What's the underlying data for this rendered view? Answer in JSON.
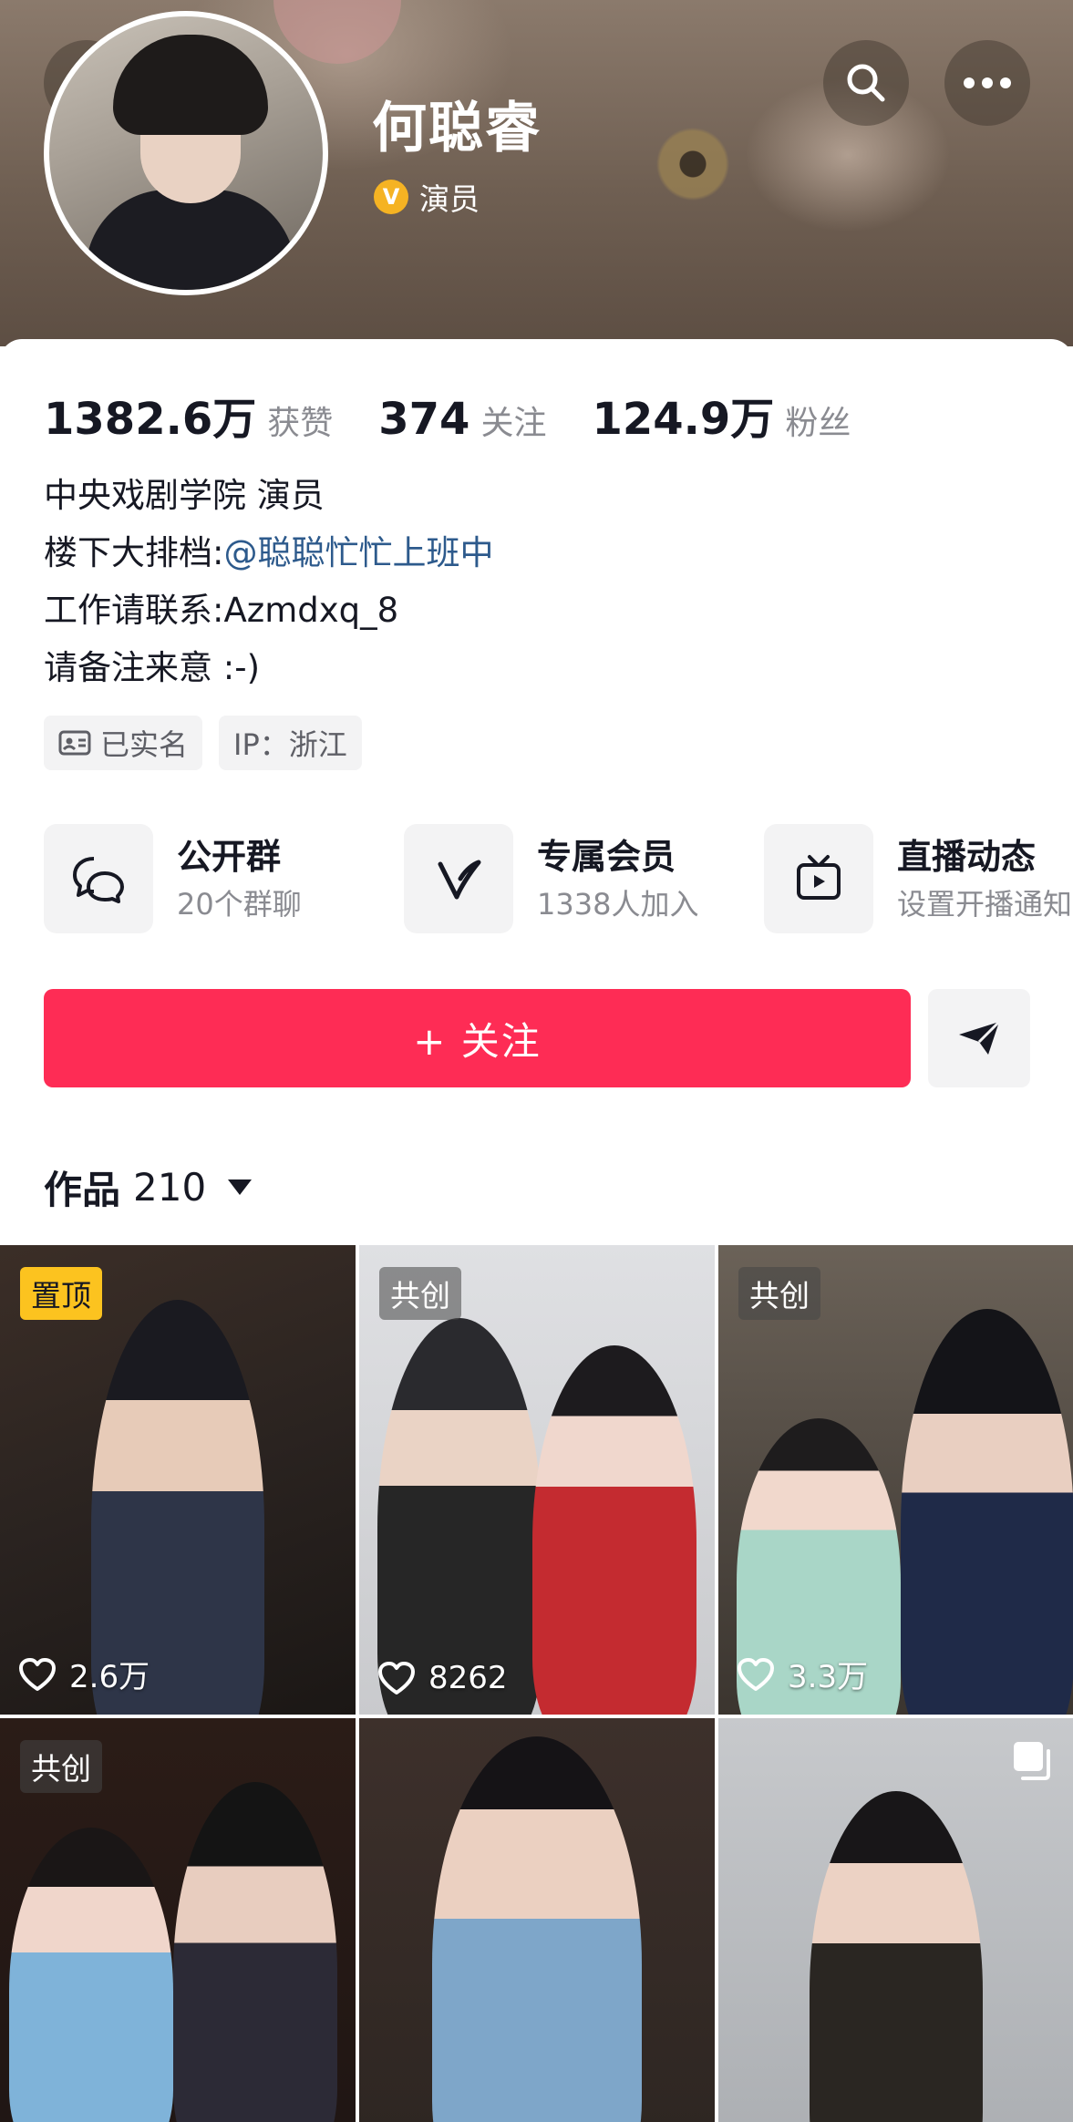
{
  "profile": {
    "name": "何聪睿",
    "verification": "演员"
  },
  "stats": [
    {
      "value": "1382.6万",
      "label": "获赞"
    },
    {
      "value": "374",
      "label": "关注"
    },
    {
      "value": "124.9万",
      "label": "粉丝"
    }
  ],
  "bio": {
    "line1": "中央戏剧学院 演员",
    "line2_prefix": "楼下大排档:",
    "line2_mention": "@聪聪忙忙上班中",
    "line3": "工作请联系:Azmdxq_8",
    "line4": "请备注来意 :-)"
  },
  "tags": [
    {
      "label": "已实名",
      "icon": "id-card-icon"
    },
    {
      "label": "IP：浙江"
    }
  ],
  "features": [
    {
      "title": "公开群",
      "subtitle": "20个群聊",
      "icon": "chat-bubbles-icon"
    },
    {
      "title": "专属会员",
      "subtitle": "1338人加入",
      "icon": "v-member-icon"
    },
    {
      "title": "直播动态",
      "subtitle": "设置开播通知",
      "icon": "tv-live-icon"
    }
  ],
  "actions": {
    "follow_label": "+ 关注"
  },
  "works": {
    "label": "作品",
    "count": "210"
  },
  "videos": [
    {
      "badge": "置顶",
      "likes": "2.6万"
    },
    {
      "badge": "共创",
      "likes": "8262"
    },
    {
      "badge": "共创",
      "likes": "3.3万"
    },
    {
      "badge": "共创",
      "likes": ""
    },
    {
      "badge": "",
      "likes": ""
    },
    {
      "badge": "",
      "likes": ""
    }
  ],
  "colors": {
    "accent": "#fe2c55",
    "pin_badge": "#fcc31f",
    "verify": "#f5b323",
    "mention": "#2d5a8c"
  }
}
